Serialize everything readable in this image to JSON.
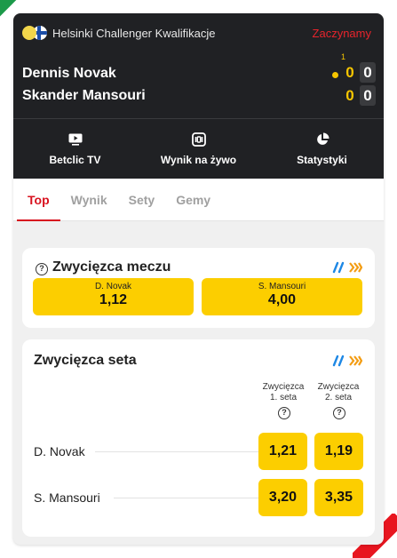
{
  "header": {
    "tournament": "Helsinki Challenger Kwalifikacje",
    "status": "Zaczynamy",
    "serve_count": "1",
    "players": [
      {
        "name": "Dennis Novak",
        "points": "0",
        "games": "0",
        "serving": true
      },
      {
        "name": "Skander Mansouri",
        "points": "0",
        "games": "0",
        "serving": false
      }
    ],
    "actions": [
      {
        "label": "Betclic TV",
        "icon": "tv-icon"
      },
      {
        "label": "Wynik na żywo",
        "icon": "live-score-icon"
      },
      {
        "label": "Statystyki",
        "icon": "pie-chart-icon"
      }
    ]
  },
  "tabs": [
    {
      "label": "Top",
      "active": true
    },
    {
      "label": "Wynik",
      "active": false
    },
    {
      "label": "Sety",
      "active": false
    },
    {
      "label": "Gemy",
      "active": false
    }
  ],
  "match_winner": {
    "title": "Zwycięzca meczu",
    "help": "?",
    "options": [
      {
        "name": "D. Novak",
        "odds": "1,12"
      },
      {
        "name": "S. Mansouri",
        "odds": "4,00"
      }
    ]
  },
  "set_winner": {
    "title": "Zwycięzca seta",
    "columns": [
      {
        "line1": "Zwycięzca",
        "line2": "1. seta"
      },
      {
        "line1": "Zwycięzca",
        "line2": "2. seta"
      }
    ],
    "help": "?",
    "rows": [
      {
        "name": "D. Novak",
        "odds": [
          "1,21",
          "1,19"
        ]
      },
      {
        "name": "S. Mansouri",
        "odds": [
          "3,20",
          "3,35"
        ]
      }
    ]
  },
  "colors": {
    "accent_red": "#d8121f",
    "odds_yellow": "#fcce00",
    "header_dark": "#202124",
    "brand_blue": "#1e88e5",
    "brand_orange": "#f39c12"
  }
}
